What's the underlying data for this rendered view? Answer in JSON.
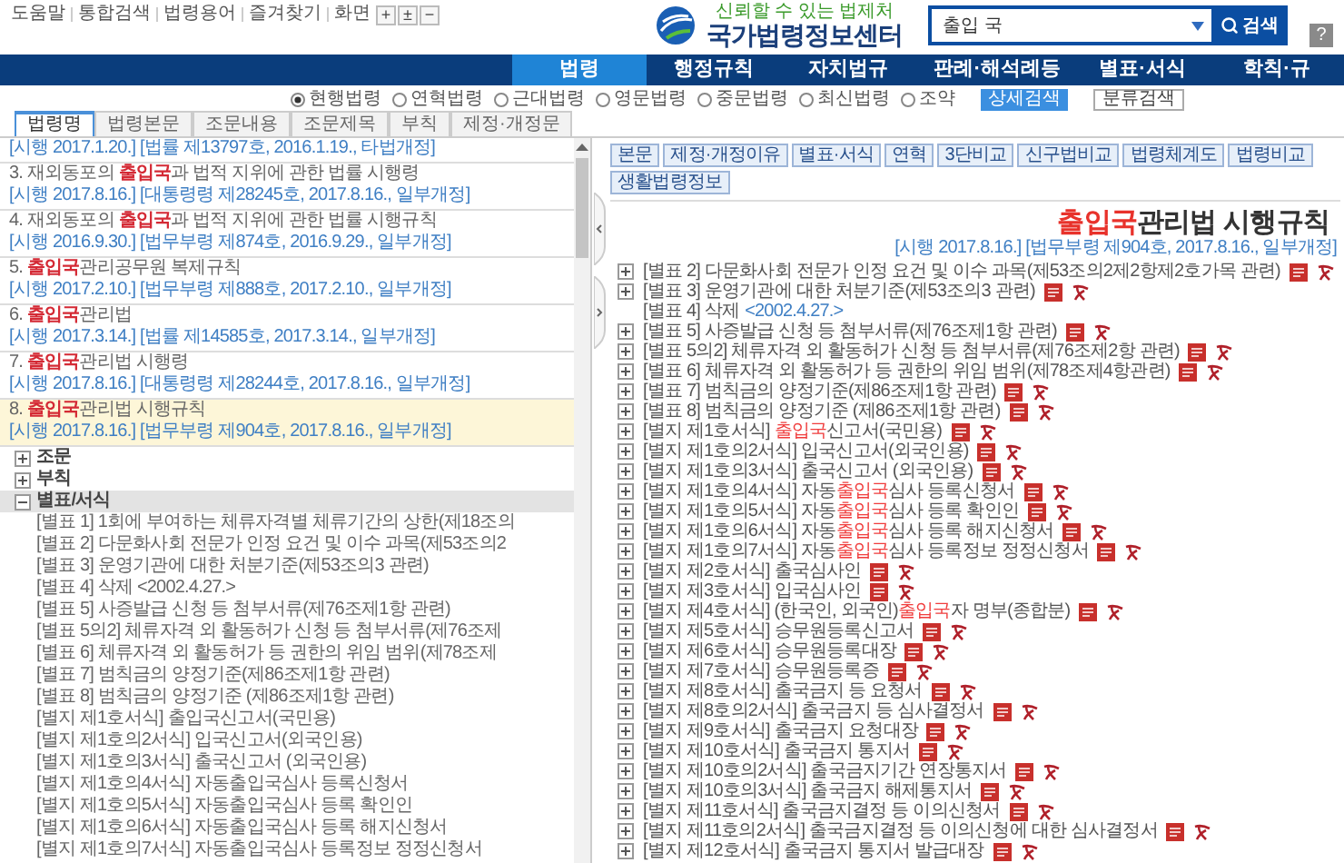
{
  "top_links": [
    "도움말",
    "통합검색",
    "법령용어",
    "즐겨찾기"
  ],
  "screen_zoom": {
    "label": "화면",
    "buttons": [
      "+",
      "±",
      "−"
    ]
  },
  "logo": {
    "slogan": "신뢰할 수 있는 법제처",
    "name": "국가법령정보센터"
  },
  "search": {
    "value": "출입 국",
    "button": "검색",
    "help": "?"
  },
  "nav": [
    {
      "label": "법령",
      "selected": true
    },
    {
      "label": "행정규칙",
      "selected": false
    },
    {
      "label": "자치법규",
      "selected": false
    },
    {
      "label": "판례·해석례등",
      "selected": false
    },
    {
      "label": "별표·서식",
      "selected": false
    },
    {
      "label": "학칙·규",
      "selected": false
    }
  ],
  "scope_options": [
    {
      "label": "현행법령",
      "selected": true
    },
    {
      "label": "연혁법령",
      "selected": false
    },
    {
      "label": "근대법령",
      "selected": false
    },
    {
      "label": "영문법령",
      "selected": false
    },
    {
      "label": "중문법령",
      "selected": false
    },
    {
      "label": "최신법령",
      "selected": false
    },
    {
      "label": "조약",
      "selected": false
    }
  ],
  "detail_search": "상세검색",
  "category_search": "분류검색",
  "left_tabs": [
    {
      "label": "법령명",
      "selected": true
    },
    {
      "label": "법령본문",
      "selected": false
    },
    {
      "label": "조문내용",
      "selected": false
    },
    {
      "label": "조문제목",
      "selected": false
    },
    {
      "label": "부칙",
      "selected": false
    },
    {
      "label": "제정·개정문",
      "selected": false
    }
  ],
  "results": [
    {
      "meta": "[시행 2017.1.20.] [법률 제13797호, 2016.1.19., 타법개정]",
      "selected": false
    },
    {
      "title_parts": [
        {
          "text": "3. 재외동포의 ",
          "highlight": false
        },
        {
          "text": "출입국",
          "highlight": true
        },
        {
          "text": "과 법적 지위에 관한 법률 시행령",
          "highlight": false
        }
      ],
      "meta": "[시행 2017.8.16.] [대통령령 제28245호, 2017.8.16., 일부개정]",
      "selected": false
    },
    {
      "title_parts": [
        {
          "text": "4. 재외동포의 ",
          "highlight": false
        },
        {
          "text": "출입국",
          "highlight": true
        },
        {
          "text": "과 법적 지위에 관한 법률 시행규칙",
          "highlight": false
        }
      ],
      "meta": "[시행 2016.9.30.] [법무부령 제874호, 2016.9.29., 일부개정]",
      "selected": false
    },
    {
      "title_parts": [
        {
          "text": "5. ",
          "highlight": false
        },
        {
          "text": "출입국",
          "highlight": true
        },
        {
          "text": "관리공무원 복제규칙",
          "highlight": false
        }
      ],
      "meta": "[시행 2017.2.10.] [법무부령 제888호, 2017.2.10., 일부개정]",
      "selected": false
    },
    {
      "title_parts": [
        {
          "text": "6. ",
          "highlight": false
        },
        {
          "text": "출입국",
          "highlight": true
        },
        {
          "text": "관리법",
          "highlight": false
        }
      ],
      "meta": "[시행 2017.3.14.] [법률 제14585호, 2017.3.14., 일부개정]",
      "selected": false
    },
    {
      "title_parts": [
        {
          "text": "7. ",
          "highlight": false
        },
        {
          "text": "출입국",
          "highlight": true
        },
        {
          "text": "관리법 시행령",
          "highlight": false
        }
      ],
      "meta": "[시행 2017.8.16.] [대통령령 제28244호, 2017.8.16., 일부개정]",
      "selected": false
    },
    {
      "title_parts": [
        {
          "text": "8. ",
          "highlight": false
        },
        {
          "text": "출입국",
          "highlight": true
        },
        {
          "text": "관리법 시행규칙",
          "highlight": false
        }
      ],
      "meta": "[시행 2017.8.16.] [법무부령 제904호, 2017.8.16., 일부개정]",
      "selected": true
    }
  ],
  "tree": [
    {
      "label": "조문",
      "expanded": false,
      "selected": false
    },
    {
      "label": "부칙",
      "expanded": false,
      "selected": false
    },
    {
      "label": "별표/서식",
      "expanded": true,
      "selected": true,
      "children": [
        {
          "label": "[별표 1] 1회에 부여하는 체류자격별 체류기간의 상한(제18조의"
        },
        {
          "label": "[별표 2] 다문화사회 전문가 인정 요건 및 이수 과목(제53조의2"
        },
        {
          "label": "[별표 3] 운영기관에 대한 처분기준(제53조의3 관련)"
        },
        {
          "label": "[별표 4] 삭제 <2002.4.27.>"
        },
        {
          "label": "[별표 5] 사증발급 신청 등 첨부서류(제76조제1항 관련)"
        },
        {
          "label": "[별표 5의2] 체류자격 외 활동허가 신청 등 첨부서류(제76조제"
        },
        {
          "label": "[별표 6] 체류자격 외 활동허가 등 권한의 위임 범위(제78조제"
        },
        {
          "label": "[별표 7] 범칙금의 양정기준(제86조제1항 관련)"
        },
        {
          "label": "[별표 8] 범칙금의 양정기준 (제86조제1항 관련)"
        },
        {
          "label": "[별지 제1호서식] 출입국신고서(국민용)"
        },
        {
          "label": "[별지 제1호의2서식] 입국신고서(외국인용)"
        },
        {
          "label": "[별지 제1호의3서식] 출국신고서 (외국인용)"
        },
        {
          "label": "[별지 제1호의4서식] 자동출입국심사 등록신청서"
        },
        {
          "label": "[별지 제1호의5서식] 자동출입국심사 등록 확인인"
        },
        {
          "label": "[별지 제1호의6서식] 자동출입국심사 등록 해지신청서"
        },
        {
          "label": "[별지 제1호의7서식] 자동출입국심사 등록정보 정정신청서"
        }
      ]
    }
  ],
  "right_buttons": [
    "본문",
    "제정·개정이유",
    "별표·서식",
    "연혁",
    "3단비교",
    "신구법비교",
    "법령체계도",
    "법령비교",
    "생활법령정보"
  ],
  "law_title_parts": [
    {
      "text": "출입국",
      "highlight": true
    },
    {
      "text": "관리법 시행규칙",
      "highlight": false
    }
  ],
  "law_meta": "[시행 2017.8.16.] [법무부령 제904호, 2017.8.16., 일부개정]",
  "attachments": [
    {
      "kind": "form",
      "parts": [
        {
          "text": "[별표 2] 다문화사회 전문가 인정 요건 및 이수 과목(제53조의2제2항제2호가목 관련)",
          "highlight": false
        }
      ]
    },
    {
      "kind": "form",
      "parts": [
        {
          "text": "[별표 3] 운영기관에 대한 처분기준(제53조의3 관련)",
          "highlight": false
        }
      ]
    },
    {
      "kind": "deleted",
      "parts": [
        {
          "text": "[별표 4] 삭제",
          "highlight": false
        }
      ],
      "note": "<2002.4.27.>"
    },
    {
      "kind": "form",
      "parts": [
        {
          "text": "[별표 5] 사증발급 신청 등 첨부서류(제76조제1항 관련)",
          "highlight": false
        }
      ]
    },
    {
      "kind": "form",
      "parts": [
        {
          "text": "[별표 5의2] 체류자격 외 활동허가 신청 등 첨부서류(제76조제2항 관련)",
          "highlight": false
        }
      ]
    },
    {
      "kind": "form",
      "parts": [
        {
          "text": "[별표 6] 체류자격 외 활동허가 등 권한의 위임 범위(제78조제4항관련)",
          "highlight": false
        }
      ]
    },
    {
      "kind": "form",
      "parts": [
        {
          "text": "[별표 7] 범칙금의 양정기준(제86조제1항 관련)",
          "highlight": false
        }
      ]
    },
    {
      "kind": "form",
      "parts": [
        {
          "text": "[별표 8] 범칙금의 양정기준 (제86조제1항 관련)",
          "highlight": false
        }
      ]
    },
    {
      "kind": "form",
      "parts": [
        {
          "text": "[별지 제1호서식] ",
          "highlight": false
        },
        {
          "text": "출입국",
          "highlight": true
        },
        {
          "text": "신고서(국민용)",
          "highlight": false
        }
      ]
    },
    {
      "kind": "form",
      "parts": [
        {
          "text": "[별지 제1호의2서식] 입국신고서(외국인용)",
          "highlight": false
        }
      ]
    },
    {
      "kind": "form",
      "parts": [
        {
          "text": "[별지 제1호의3서식] 출국신고서 (외국인용)",
          "highlight": false
        }
      ]
    },
    {
      "kind": "form",
      "parts": [
        {
          "text": "[별지 제1호의4서식] 자동",
          "highlight": false
        },
        {
          "text": "출입국",
          "highlight": true
        },
        {
          "text": "심사 등록신청서",
          "highlight": false
        }
      ]
    },
    {
      "kind": "form",
      "parts": [
        {
          "text": "[별지 제1호의5서식] 자동",
          "highlight": false
        },
        {
          "text": "출입국",
          "highlight": true
        },
        {
          "text": "심사 등록 확인인",
          "highlight": false
        }
      ]
    },
    {
      "kind": "form",
      "parts": [
        {
          "text": "[별지 제1호의6서식] 자동",
          "highlight": false
        },
        {
          "text": "출입국",
          "highlight": true
        },
        {
          "text": "심사 등록 해지신청서",
          "highlight": false
        }
      ]
    },
    {
      "kind": "form",
      "parts": [
        {
          "text": "[별지 제1호의7서식] 자동",
          "highlight": false
        },
        {
          "text": "출입국",
          "highlight": true
        },
        {
          "text": "심사 등록정보 정정신청서",
          "highlight": false
        }
      ]
    },
    {
      "kind": "form",
      "parts": [
        {
          "text": "[별지 제2호서식] 출국심사인",
          "highlight": false
        }
      ]
    },
    {
      "kind": "form",
      "parts": [
        {
          "text": "[별지 제3호서식] 입국심사인",
          "highlight": false
        }
      ]
    },
    {
      "kind": "form",
      "parts": [
        {
          "text": "[별지 제4호서식] (한국인, 외국인)",
          "highlight": false
        },
        {
          "text": "출입국",
          "highlight": true
        },
        {
          "text": "자 명부(종합분)",
          "highlight": false
        }
      ]
    },
    {
      "kind": "form",
      "parts": [
        {
          "text": "[별지 제5호서식] 승무원등록신고서",
          "highlight": false
        }
      ]
    },
    {
      "kind": "form",
      "parts": [
        {
          "text": "[별지 제6호서식] 승무원등록대장",
          "highlight": false
        }
      ]
    },
    {
      "kind": "form",
      "parts": [
        {
          "text": "[별지 제7호서식] 승무원등록증",
          "highlight": false
        }
      ]
    },
    {
      "kind": "form",
      "parts": [
        {
          "text": "[별지 제8호서식] 출국금지 등 요청서",
          "highlight": false
        }
      ]
    },
    {
      "kind": "form",
      "parts": [
        {
          "text": "[별지 제8호의2서식] 출국금지 등 심사결정서",
          "highlight": false
        }
      ]
    },
    {
      "kind": "form",
      "parts": [
        {
          "text": "[별지 제9호서식] 출국금지 요청대장",
          "highlight": false
        }
      ]
    },
    {
      "kind": "form",
      "parts": [
        {
          "text": "[별지 제10호서식] 출국금지 통지서",
          "highlight": false
        }
      ]
    },
    {
      "kind": "form",
      "parts": [
        {
          "text": "[별지 제10호의2서식] 출국금지기간 연장통지서",
          "highlight": false
        }
      ]
    },
    {
      "kind": "form",
      "parts": [
        {
          "text": "[별지 제10호의3서식] 출국금지 해제통지서",
          "highlight": false
        }
      ]
    },
    {
      "kind": "form",
      "parts": [
        {
          "text": "[별지 제11호서식] 출국금지결정 등 이의신청서",
          "highlight": false
        }
      ]
    },
    {
      "kind": "form",
      "parts": [
        {
          "text": "[별지 제11호의2서식] 출국금지결정 등 이의신청에 대한 심사결정서",
          "highlight": false
        }
      ]
    },
    {
      "kind": "form",
      "parts": [
        {
          "text": "[별지 제12호서식] 출국금지 통지서 발급대장",
          "highlight": false
        }
      ]
    }
  ]
}
